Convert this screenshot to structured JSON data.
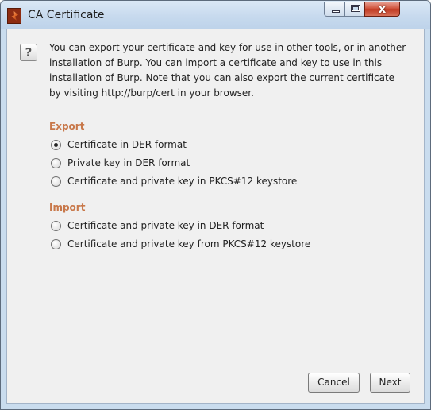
{
  "window": {
    "title": "CA Certificate",
    "close_glyph": "x",
    "icons": [
      "burp-app-icon",
      "minimize-icon",
      "maximize-icon",
      "close-icon",
      "help-icon"
    ]
  },
  "intro": {
    "text": "You can export your certificate and key for use in other tools, or in another installation of Burp. You can import a certificate and key to use in this installation of Burp. Note that you can also export the current certificate by visiting http://burp/cert in your browser."
  },
  "help_icon_glyph": "?",
  "export": {
    "heading": "Export",
    "options": [
      {
        "label": "Certificate in DER format",
        "selected": true
      },
      {
        "label": "Private key in DER format",
        "selected": false
      },
      {
        "label": "Certificate and private key in PKCS#12 keystore",
        "selected": false
      }
    ]
  },
  "import": {
    "heading": "Import",
    "options": [
      {
        "label": "Certificate and private key in DER format",
        "selected": false
      },
      {
        "label": "Certificate and private key from PKCS#12 keystore",
        "selected": false
      }
    ]
  },
  "buttons": {
    "cancel": "Cancel",
    "next": "Next"
  },
  "colors": {
    "section_heading": "#c8784a",
    "title_bar": "#c9dcee",
    "close_button": "#c13a22"
  }
}
